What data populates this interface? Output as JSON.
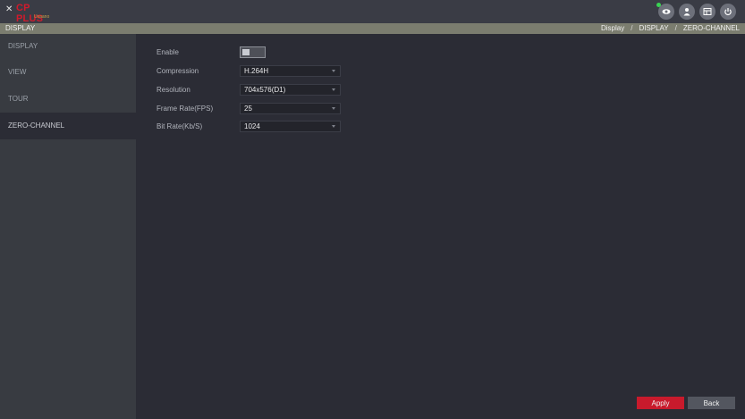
{
  "header": {
    "brand": "CP PLUS",
    "brand_sub": "Uvaano",
    "icons": [
      "eye-icon",
      "user-icon",
      "list-icon",
      "power-icon"
    ]
  },
  "titlebar": {
    "title": "DISPLAY",
    "breadcrumb": [
      "Display",
      "DISPLAY",
      "ZERO-CHANNEL"
    ]
  },
  "sidebar": {
    "items": [
      {
        "label": "DISPLAY",
        "active": false
      },
      {
        "label": "VIEW",
        "active": false
      },
      {
        "label": "TOUR",
        "active": false
      },
      {
        "label": "ZERO-CHANNEL",
        "active": true
      }
    ]
  },
  "form": {
    "enable": {
      "label": "Enable",
      "value": false
    },
    "compression": {
      "label": "Compression",
      "value": "H.264H"
    },
    "resolution": {
      "label": "Resolution",
      "value": "704x576(D1)"
    },
    "frame_rate": {
      "label": "Frame Rate(FPS)",
      "value": "25"
    },
    "bit_rate": {
      "label": "Bit Rate(Kb/S)",
      "value": "1024"
    }
  },
  "buttons": {
    "apply": "Apply",
    "back": "Back"
  },
  "colors": {
    "accent": "#c81a2c",
    "background": "#2b2c35",
    "sidebar": "#383b41",
    "titlebar": "#7b7d6f"
  }
}
